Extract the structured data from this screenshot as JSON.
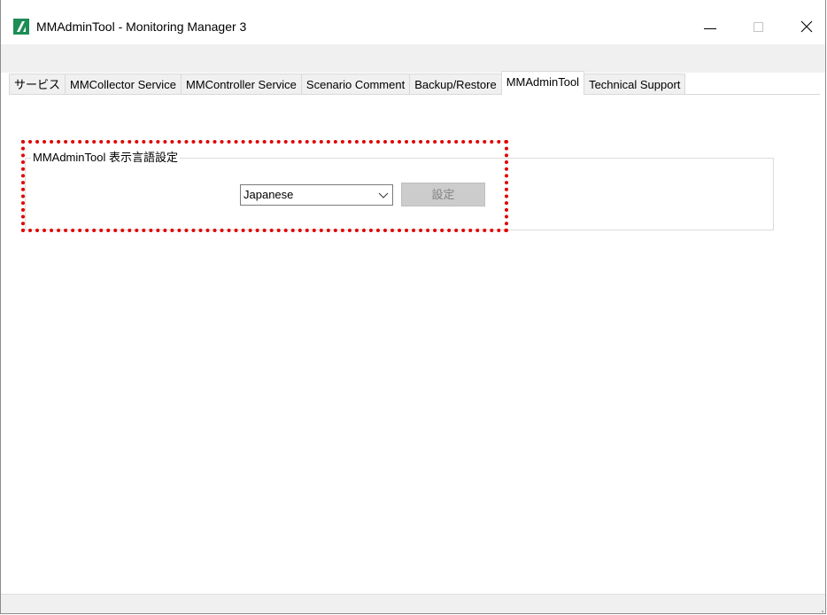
{
  "window": {
    "title": "MMAdminTool - Monitoring Manager 3",
    "icon": "app-logo-icon",
    "brand_color": "#1d8c55",
    "buttons": [
      "minimize-icon",
      "maximize-icon",
      "close-icon"
    ]
  },
  "tabs": [
    {
      "label": "サービス",
      "active": false
    },
    {
      "label": "MMCollector Service",
      "active": false
    },
    {
      "label": "MMController Service",
      "active": false
    },
    {
      "label": "Scenario Comment",
      "active": false
    },
    {
      "label": "Backup/Restore",
      "active": false
    },
    {
      "label": "MMAdminTool",
      "active": true
    },
    {
      "label": "Technical Support",
      "active": false
    }
  ],
  "language_group": {
    "title": "MMAdminTool 表示言語設定",
    "language_select": {
      "value": "Japanese"
    },
    "set_button": {
      "label": "設定",
      "enabled": false
    }
  },
  "annotation": {
    "highlight_color": "#e00000"
  }
}
